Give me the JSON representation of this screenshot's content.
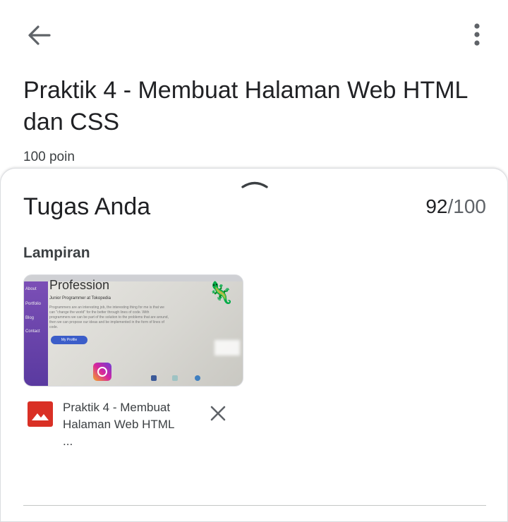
{
  "header": {
    "back_icon": "arrow-back-icon",
    "menu_icon": "more-vert-icon",
    "title": "Praktik 4 - Membuat Halaman Web HTML dan CSS",
    "points": "100 poin"
  },
  "sheet": {
    "handle_icon": "chevron-up-icon",
    "title": "Tugas Anda",
    "grade": {
      "score": "92",
      "max": "/100"
    },
    "attachments_label": "Lampiran",
    "attachment": {
      "thumbnail": {
        "heading": "Profession",
        "subtitle": "Junior Programmer at Tokopedia",
        "paragraph": "Programmers are an interesting job, the interesting thing for me is that we can \"change the world\" for the better through lines of code. With programmers we can be part of the solution to the problems that are around, then we can propose our ideas and be implemented in the form of lines of code.",
        "button": "My Profile",
        "nav": [
          "About",
          "Portfolio",
          "Blog",
          "Contact"
        ]
      },
      "file_icon": "image-file-icon",
      "file_name": "Praktik 4 - Membuat Halaman Web HTML ...",
      "remove_icon": "close-icon"
    }
  },
  "colors": {
    "accent": "#d93025",
    "text": "#202124",
    "secondary": "#5f6368"
  }
}
